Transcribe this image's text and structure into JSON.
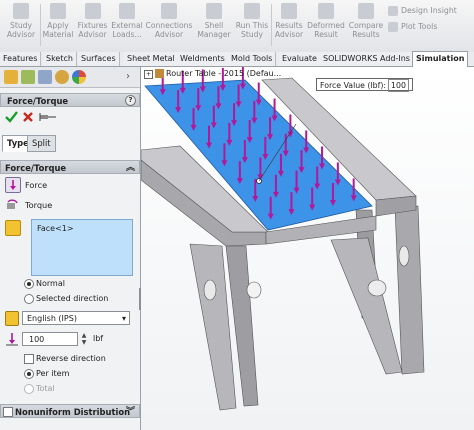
{
  "ribbon": {
    "buttons": [
      {
        "label": "Study\nAdvisor",
        "icon": "study-advisor-icon"
      },
      {
        "label": "Apply\nMaterial",
        "icon": "apply-material-icon"
      },
      {
        "label": "Fixtures\nAdvisor",
        "icon": "fixtures-advisor-icon"
      },
      {
        "label": "External\nLoads...",
        "icon": "external-loads-icon"
      },
      {
        "label": "Connections\nAdvisor",
        "icon": "connections-advisor-icon"
      },
      {
        "label": "Shell\nManager",
        "icon": "shell-manager-icon"
      },
      {
        "label": "Run This\nStudy",
        "icon": "run-study-icon"
      },
      {
        "label": "Results\nAdvisor",
        "icon": "results-advisor-icon"
      },
      {
        "label": "Deformed\nResult",
        "icon": "deformed-result-icon"
      },
      {
        "label": "Compare\nResults",
        "icon": "compare-results-icon"
      }
    ],
    "side_items": [
      "Design Insight",
      "Plot Tools"
    ]
  },
  "command_tabs": [
    "Features",
    "Sketch",
    "Surfaces",
    "Sheet Metal",
    "Weldments",
    "Mold Tools",
    "Evaluate",
    "SOLIDWORKS Add-Ins",
    "Simulation"
  ],
  "active_tab": "Simulation",
  "property_manager": {
    "title": "Force/Torque",
    "help": "?",
    "subtabs": [
      "Type",
      "Split"
    ],
    "active_subtab": "Type",
    "section_title": "Force/Torque",
    "type_options": [
      "Force",
      "Torque"
    ],
    "selected_entities": [
      "Face<1>"
    ],
    "direction_options": [
      "Normal",
      "Selected direction"
    ],
    "direction_selected": "Normal",
    "units": "English (IPS)",
    "force_value": "100",
    "force_unit": "lbf",
    "reverse_direction": "Reverse direction",
    "distribution_options": [
      "Per item",
      "Total"
    ],
    "distribution_selected": "Per item",
    "nonuniform_title": "Nonuniform Distribution",
    "colors": {
      "accent": "#2f6fd6",
      "force_arrow": "#b3179a",
      "ok": "#1a9d2c",
      "cancel": "#c52b1e"
    }
  },
  "graphics": {
    "tree_label": "Router Table - 2015 (Defau...",
    "callout_label": "Force Value (lbf):",
    "callout_value": "100",
    "colors": {
      "table_top": "#3d93e8",
      "steel": "#b8b8bc",
      "arrow": "#b3179a"
    }
  }
}
